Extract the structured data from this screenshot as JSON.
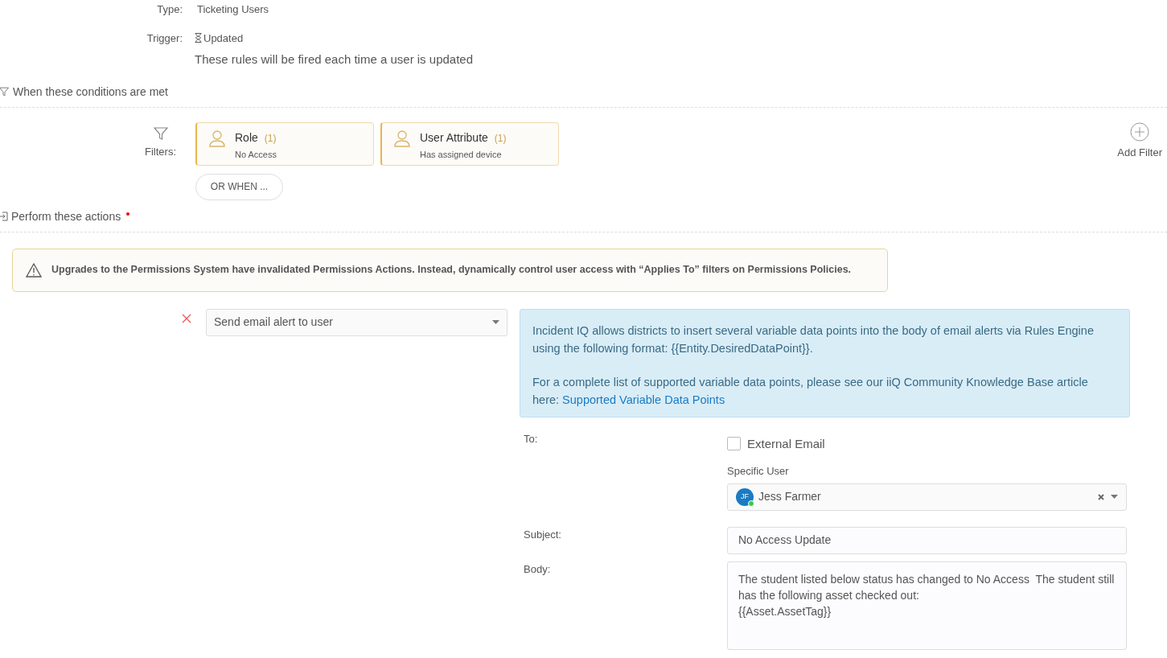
{
  "details": [
    {
      "label": "Type:",
      "value": "Ticketing Users",
      "kind": "text"
    },
    {
      "label": "Trigger:",
      "value": "Updated",
      "kind": "trigger"
    }
  ],
  "trigger_description": "These rules will be fired each time a user is updated",
  "conditions": {
    "title": "When these conditions are met",
    "filters_label": "Filters:",
    "filters": [
      {
        "name": "Role",
        "count": "(1)",
        "value": "No Access"
      },
      {
        "name": "User Attribute",
        "count": "(1)",
        "value": "Has assigned device"
      }
    ],
    "or_when": "OR WHEN ...",
    "add_filter": "Add Filter"
  },
  "actions": {
    "title": "Perform these actions",
    "required": true,
    "warning": "Upgrades to the Permissions System have invalidated Permissions Actions. Instead, dynamically control user access with “Applies To” filters on Permissions Policies.",
    "action": {
      "value": "Send email alert to user",
      "info": {
        "paragraph_1": "Incident IQ allows districts to insert several variable data points into the body of email alerts via Rules Engine using the following format: {{Entity.DesiredDataPoint}}.",
        "paragraph_2": "For a complete list of supported variable data points, please see our iiQ Community Knowledge Base article here:",
        "link": "Supported Variable Data Points"
      },
      "to_label": "To:",
      "external_email": {
        "label": "External Email",
        "checked": false
      },
      "specific_user_label": "Specific User",
      "user": {
        "initials": "JF",
        "name": "Jess Farmer",
        "online": true
      },
      "subject_label": "Subject:",
      "subject": "No Access Update",
      "body_label": "Body:",
      "body": "The student listed below status has changed to No Access  The student still has the following asset checked out:\n{{Asset.AssetTag}}"
    }
  }
}
